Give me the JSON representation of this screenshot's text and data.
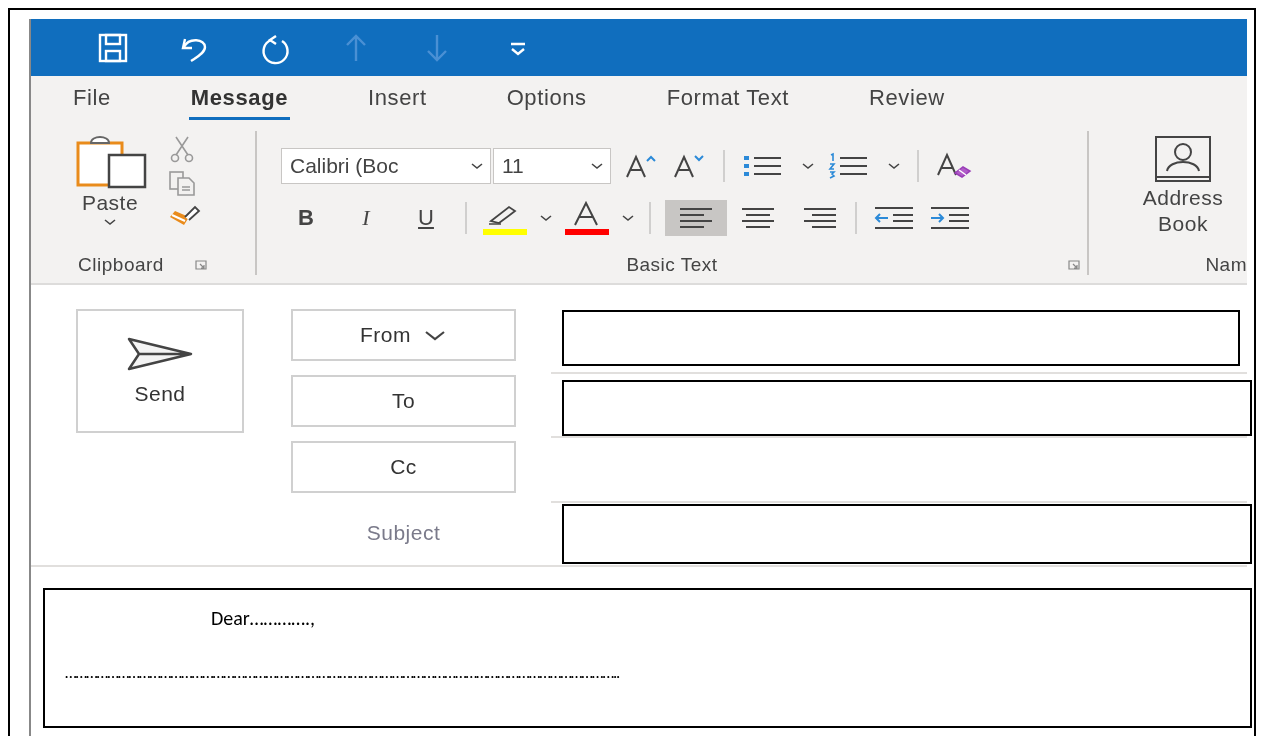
{
  "quick_access": [
    {
      "kind": "save",
      "disabled": false
    },
    {
      "kind": "undo",
      "disabled": false
    },
    {
      "kind": "redo",
      "disabled": false
    },
    {
      "kind": "up",
      "disabled": true
    },
    {
      "kind": "down",
      "disabled": true
    },
    {
      "kind": "customize",
      "disabled": false
    }
  ],
  "tabs": [
    {
      "label": "File",
      "selected": false
    },
    {
      "label": "Message",
      "selected": true
    },
    {
      "label": "Insert",
      "selected": false
    },
    {
      "label": "Options",
      "selected": false
    },
    {
      "label": "Format Text",
      "selected": false
    },
    {
      "label": "Review",
      "selected": false
    }
  ],
  "ribbon": {
    "clipboard": {
      "paste_label": "Paste",
      "group_label": "Clipboard"
    },
    "basic_text": {
      "font_name": "Calibri (Boc",
      "font_size": "11",
      "group_label": "Basic Text",
      "styles": [
        "B",
        "I",
        "U"
      ],
      "alignment": [
        {
          "kind": "left",
          "selected": true
        },
        {
          "kind": "center",
          "selected": false
        },
        {
          "kind": "right",
          "selected": false
        }
      ]
    },
    "names": {
      "address_book_label": "Address Book",
      "group_label": "Nam"
    }
  },
  "compose": {
    "send_label": "Send",
    "from_label": "From",
    "to_label": "To",
    "cc_label": "Cc",
    "subject_label": "Subject"
  },
  "answer_body": {
    "greeting": "Dear………….,",
    "line": "………………………………………………………………………………………………………………………………………….."
  }
}
